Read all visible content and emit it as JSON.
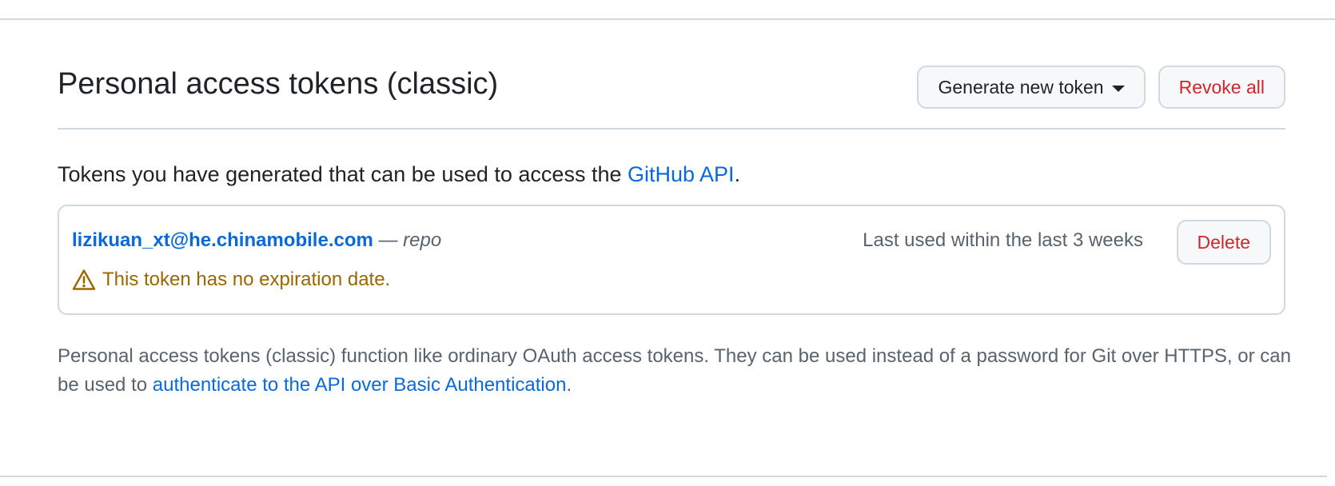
{
  "header": {
    "title": "Personal access tokens (classic)",
    "generate_label": "Generate new token",
    "revoke_label": "Revoke all"
  },
  "intro": {
    "text": "Tokens you have generated that can be used to access the ",
    "link_text": "GitHub API",
    "end": "."
  },
  "token": {
    "name": "lizikuan_xt@he.chinamobile.com",
    "separator": " — ",
    "scope": "repo",
    "last_used": "Last used within the last 3 weeks",
    "delete_label": "Delete",
    "warning": "This token has no expiration date."
  },
  "footer": {
    "text": "Personal access tokens (classic) function like ordinary OAuth access tokens. They can be used instead of a password for Git over HTTPS, or can be used to ",
    "link_text": "authenticate to the API over Basic Authentication",
    "end": "."
  },
  "icons": {
    "warning": "alert-icon",
    "dropdown": "triangle-down-icon"
  },
  "colors": {
    "link": "#0969da",
    "danger": "#d1242f",
    "attention": "#9a6700",
    "muted": "#59636e",
    "border": "#d1d9e0"
  }
}
